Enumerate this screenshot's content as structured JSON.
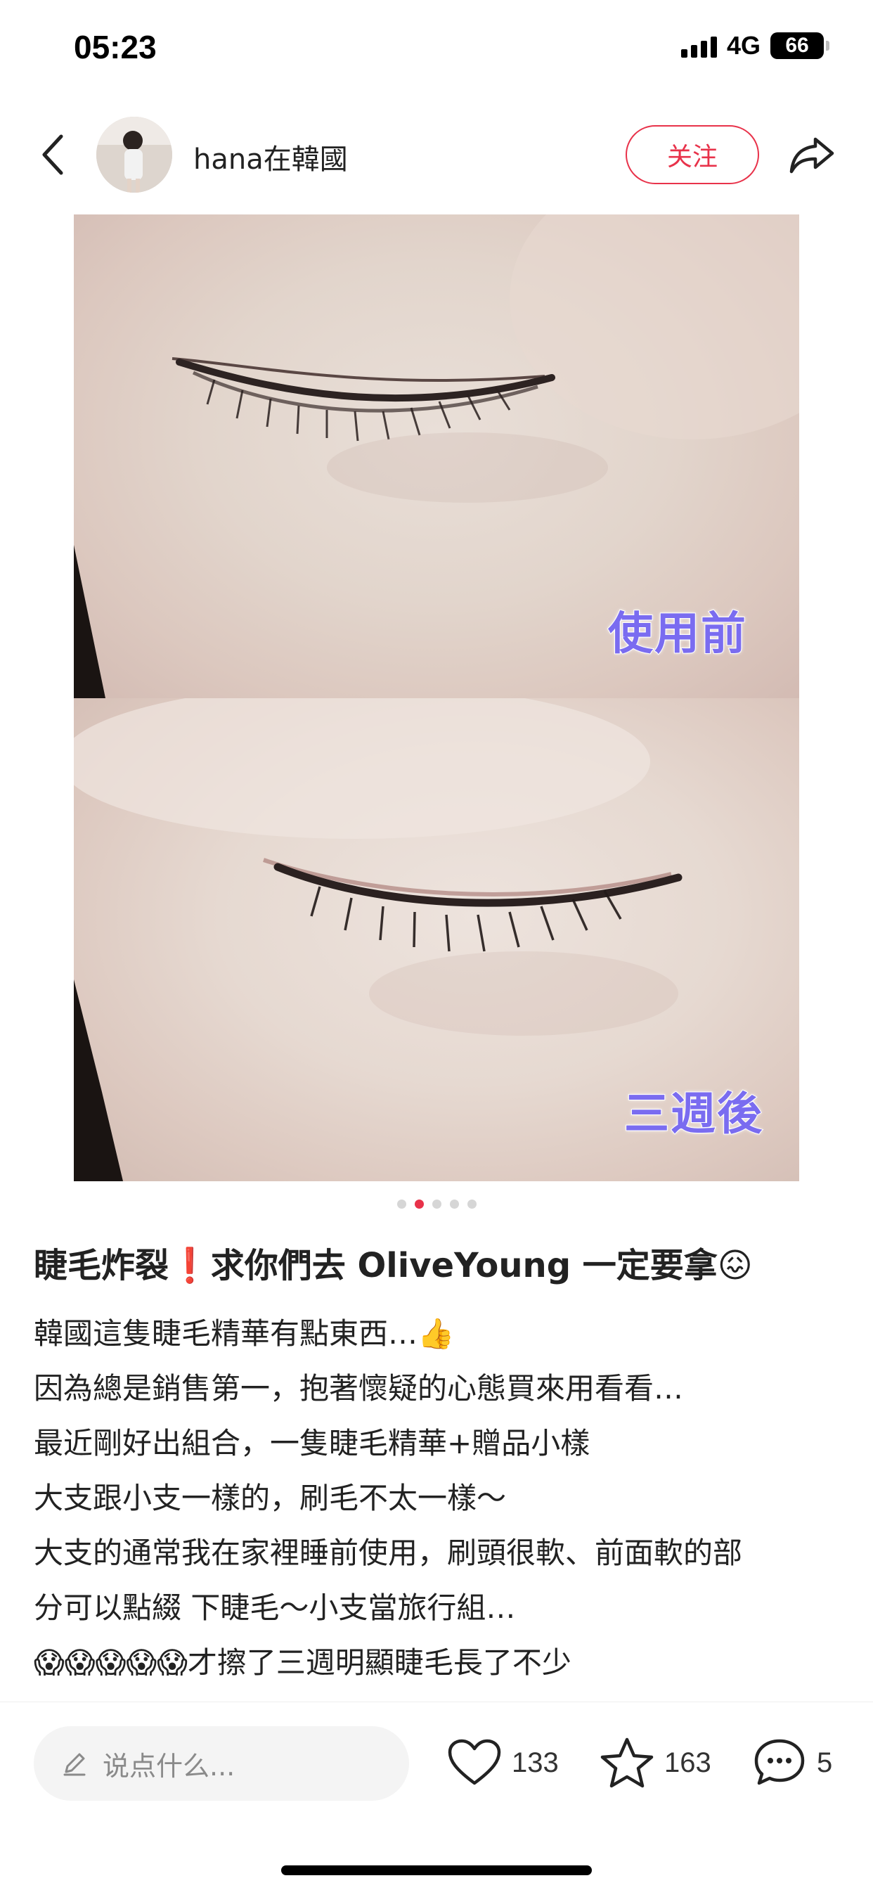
{
  "status_bar": {
    "time": "05:23",
    "network": "4G",
    "battery": "66"
  },
  "header": {
    "author_name": "hana在韓國",
    "follow_label": "关注",
    "icons": {
      "back": "chevron-left-icon",
      "share": "share-arrow-icon"
    }
  },
  "media": {
    "top_label": "使用前",
    "bottom_label": "三週後",
    "pagination": {
      "total": 5,
      "active_index": 1
    }
  },
  "post": {
    "title": "睫毛炸裂❗️求你們去 OliveYoung 一定要拿😖",
    "lines": [
      "韓國這隻睫毛精華有點東西…👍",
      "因為總是銷售第一，抱著懷疑的心態買來用看看…",
      "最近剛好出組合，一隻睫毛精華+贈品小樣",
      "大支跟小支一樣的，刷毛不太一樣～",
      "大支的通常我在家裡睡前使用，刷頭很軟、前面軟的部",
      "分可以點綴 下睫毛～小支當旅行組…",
      "😱😱😱😱😱才擦了三週明顯睫毛長了不少"
    ]
  },
  "bottom_bar": {
    "comment_placeholder": "说点什么...",
    "likes": "133",
    "collects": "163",
    "comments": "5",
    "colors": {
      "accent": "#e8324a"
    }
  }
}
